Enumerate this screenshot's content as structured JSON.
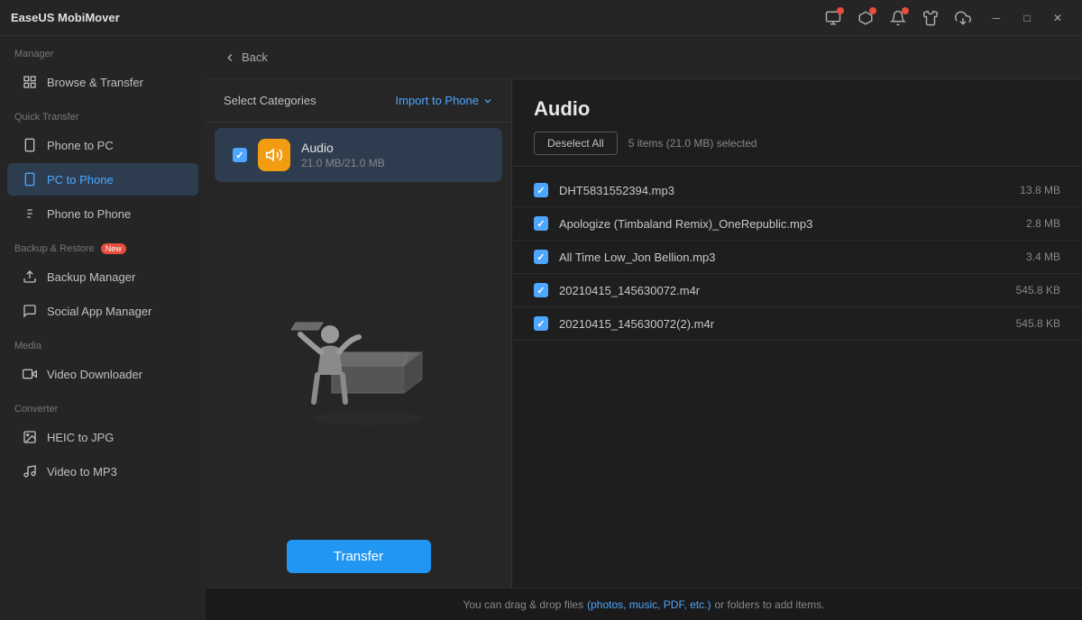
{
  "titlebar": {
    "app_name": "EaseUS MobiMover"
  },
  "sidebar": {
    "manager_label": "Manager",
    "quick_transfer_label": "Quick Transfer",
    "backup_restore_label": "Backup & Restore",
    "media_label": "Media",
    "converter_label": "Converter",
    "items": [
      {
        "id": "browse-transfer",
        "label": "Browse & Transfer",
        "icon": "⊞",
        "active": false
      },
      {
        "id": "phone-to-pc",
        "label": "Phone to PC",
        "icon": "→",
        "active": false
      },
      {
        "id": "pc-to-phone",
        "label": "PC to Phone",
        "icon": "←",
        "active": true
      },
      {
        "id": "phone-to-phone",
        "label": "Phone to Phone",
        "icon": "⇄",
        "active": false
      },
      {
        "id": "backup-manager",
        "label": "Backup Manager",
        "icon": "🗄",
        "active": false
      },
      {
        "id": "social-app-manager",
        "label": "Social App Manager",
        "icon": "💬",
        "active": false
      },
      {
        "id": "video-downloader",
        "label": "Video Downloader",
        "icon": "⬇",
        "active": false
      },
      {
        "id": "heic-to-jpg",
        "label": "HEIC to JPG",
        "icon": "🖼",
        "active": false
      },
      {
        "id": "video-to-mp3",
        "label": "Video to MP3",
        "icon": "♫",
        "active": false
      }
    ]
  },
  "topbar": {
    "back_label": "Back"
  },
  "categories_panel": {
    "title": "Select Categories",
    "import_btn_label": "Import to Phone",
    "categories": [
      {
        "name": "Audio",
        "size": "21.0 MB/21.0 MB",
        "checked": true,
        "icon": "🔊"
      }
    ]
  },
  "files_panel": {
    "title": "Audio",
    "deselect_label": "Deselect All",
    "selected_count": "5 items (21.0 MB) selected",
    "files": [
      {
        "name": "DHT5831552394.mp3",
        "size": "13.8 MB"
      },
      {
        "name": "Apologize (Timbaland Remix)_OneRepublic.mp3",
        "size": "2.8 MB"
      },
      {
        "name": "All Time Low_Jon Bellion.mp3",
        "size": "3.4 MB"
      },
      {
        "name": "20210415_145630072.m4r",
        "size": "545.8 KB"
      },
      {
        "name": "20210415_145630072(2).m4r",
        "size": "545.8 KB"
      }
    ]
  },
  "transfer_btn_label": "Transfer",
  "status_bar": {
    "text": "You can drag & drop files ",
    "highlight": "(photos, music, PDF, etc.)",
    "text2": " or folders to add items."
  }
}
